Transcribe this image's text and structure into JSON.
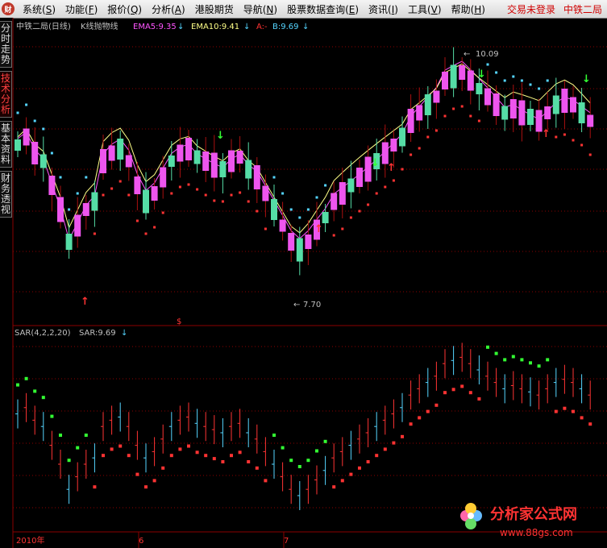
{
  "menu": {
    "items": [
      {
        "label": "系统(",
        "key": "S",
        "tail": ")"
      },
      {
        "label": "功能(",
        "key": "F",
        "tail": ")"
      },
      {
        "label": "报价(",
        "key": "Q",
        "tail": ")"
      },
      {
        "label": "分析(",
        "key": "A",
        "tail": ")"
      },
      {
        "label": "港股期货",
        "key": "",
        "tail": ""
      },
      {
        "label": "导航(",
        "key": "N",
        "tail": ")"
      },
      {
        "label": "股票数据查询(",
        "key": "E",
        "tail": ")"
      },
      {
        "label": "资讯(",
        "key": "I",
        "tail": ")"
      },
      {
        "label": "工具(",
        "key": "V",
        "tail": ")"
      },
      {
        "label": "帮助(",
        "key": "H",
        "tail": ")"
      }
    ],
    "status": "交易未登录",
    "stock": "中铁二局"
  },
  "side_tabs": [
    "分时走势",
    "技术分析",
    "基本资料",
    "财务透视"
  ],
  "main_chart": {
    "title": "中铁二局(日线)",
    "indicator": "K线抛物线",
    "ema5_label": "EMA5:9.35",
    "ema10_label": "EMA10:9.41",
    "a_label": "A:-",
    "b_label": "B:9.69",
    "high_label": "10.09",
    "low_label": "7.70",
    "marker": "$"
  },
  "sub_chart": {
    "title": "SAR(4,2,2,20)",
    "value_label": "SAR:9.69"
  },
  "axis": {
    "year_label": "2010年",
    "month_labels": [
      "6",
      "7"
    ]
  },
  "watermark": {
    "text": "分析家公式网",
    "url": "www.88gs.com"
  },
  "colors": {
    "up": "#ff3333",
    "down": "#55dda6",
    "up_candle_fill": "#ee55ee",
    "sar_blue": "#55d5ff",
    "sar_red": "#ff3333",
    "sar_green": "#33ff33",
    "ema5": "#ff55ff",
    "ema10": "#ffff88",
    "grid": "#8b0000",
    "text_gray": "#c0c0c0"
  }
}
